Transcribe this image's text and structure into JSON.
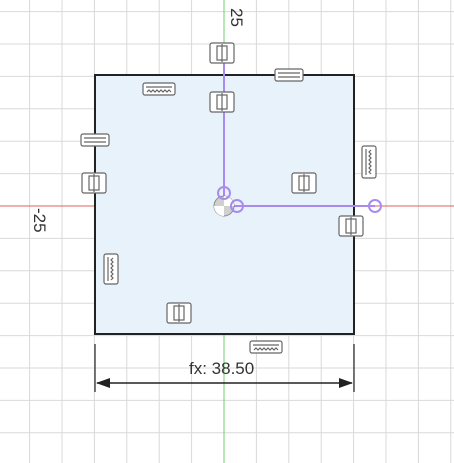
{
  "viewport": {
    "axis_labels": {
      "y_axis_top": "25",
      "x_axis_left": "-25"
    },
    "dimension": {
      "label": "fx: 38.50"
    },
    "colors": {
      "background": "#ffffff",
      "grid_minor": "#ececec",
      "grid_major": "#d9d9d9",
      "x_axis": "#e06060",
      "y_axis": "#6fcf6f",
      "profile_fill": "#e8f2fb",
      "profile_edge": "#222222",
      "sketch_accent": "#a98bf0",
      "constraint_glyph": "#666666"
    },
    "icons": [
      "sketch-origin-point-icon",
      "horizontal-constraint-icon",
      "vertical-constraint-icon",
      "midpoint-constraint-icon",
      "parallel-constraint-icon",
      "dimension-arrow-icon"
    ]
  }
}
